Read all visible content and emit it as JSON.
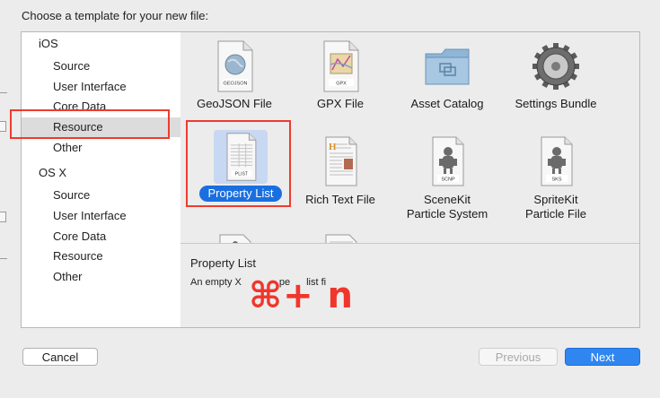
{
  "dialog": {
    "heading": "Choose a template for your new file:"
  },
  "sidebar": {
    "groups": [
      {
        "label": "iOS",
        "items": [
          "Source",
          "User Interface",
          "Core Data",
          "Resource",
          "Other"
        ]
      },
      {
        "label": "OS X",
        "items": [
          "Source",
          "User Interface",
          "Core Data",
          "Resource",
          "Other"
        ]
      }
    ],
    "selected": "iOS / Resource"
  },
  "templates": [
    {
      "label": "GeoJSON File",
      "icon": "geojson-file-icon",
      "badge": "GEOJSON"
    },
    {
      "label": "GPX File",
      "icon": "gpx-file-icon",
      "badge": "GPX"
    },
    {
      "label": "Asset Catalog",
      "icon": "asset-catalog-folder-icon"
    },
    {
      "label": "Settings Bundle",
      "icon": "settings-gear-icon"
    },
    {
      "label": "Property List",
      "icon": "plist-file-icon",
      "badge": "PLIST",
      "selected": true
    },
    {
      "label": "Rich Text File",
      "icon": "rich-text-file-icon"
    },
    {
      "label": "SceneKit Particle System",
      "line1": "SceneKit",
      "line2": "Particle System",
      "icon": "scenekit-particle-icon",
      "badge": "SCNP"
    },
    {
      "label": "SpriteKit Particle File",
      "line1": "SpriteKit",
      "line2": "Particle File",
      "icon": "spritekit-particle-icon",
      "badge": "SKS"
    }
  ],
  "description": {
    "title": "Property List",
    "text_left": "An empty X",
    "text_right": "pe",
    "text_end": "list fi"
  },
  "overlay": {
    "shortcut": "⌘+ n"
  },
  "buttons": {
    "cancel": "Cancel",
    "previous": "Previous",
    "next": "Next"
  },
  "colors": {
    "accent": "#2f86f0",
    "selection_pill": "#1a6fe0",
    "annotation": "#ee3b2f"
  }
}
